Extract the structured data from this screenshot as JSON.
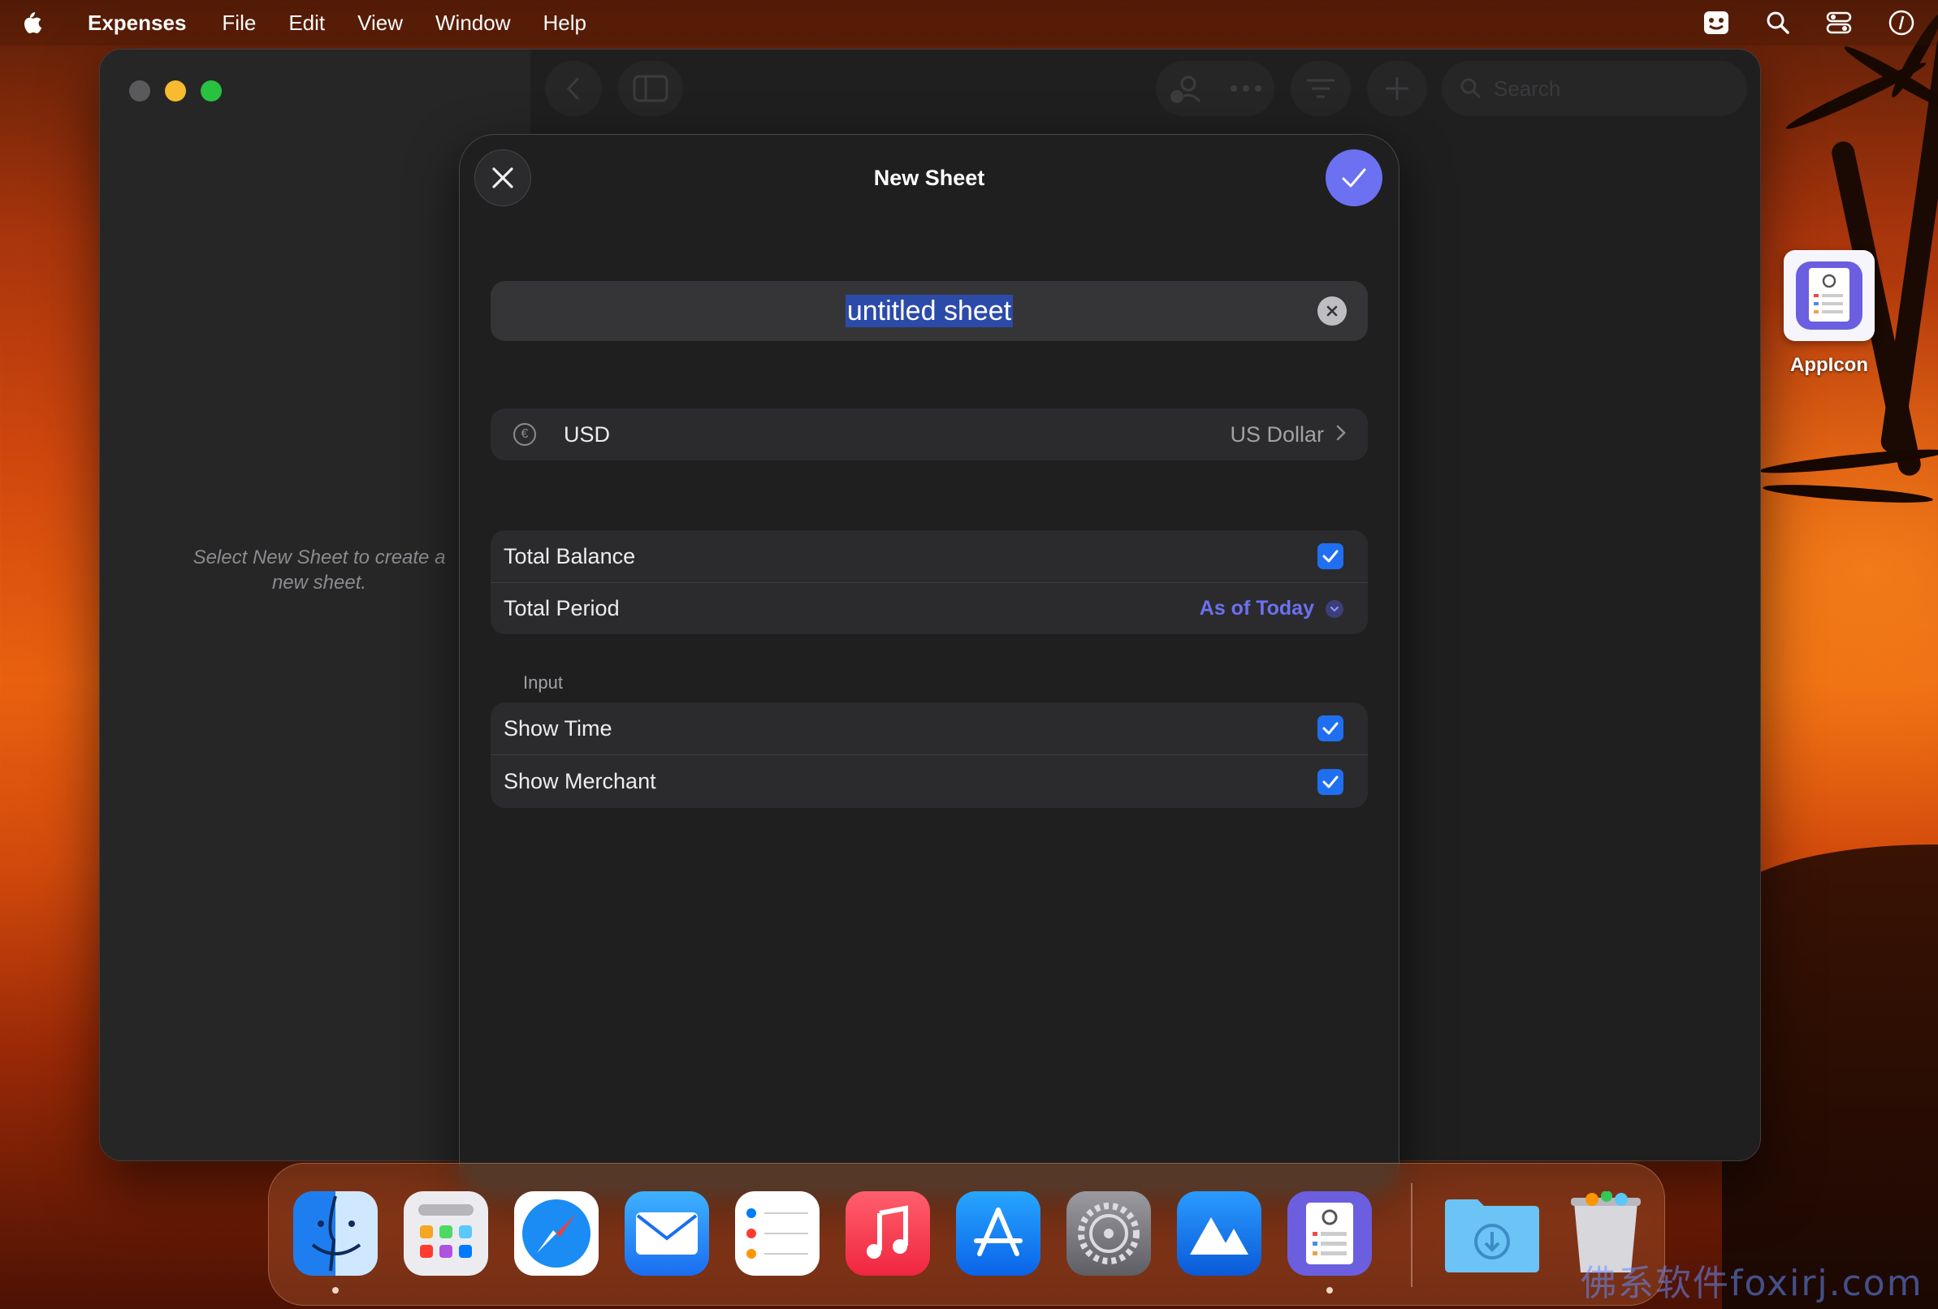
{
  "menubar": {
    "app_name": "Expenses",
    "items": [
      "File",
      "Edit",
      "View",
      "Window",
      "Help"
    ]
  },
  "window": {
    "sidebar_placeholder": "Select New Sheet to create a\nnew sheet.",
    "search_placeholder": "Search"
  },
  "sheet": {
    "title": "New Sheet",
    "name_value": "untitled sheet",
    "currency": {
      "code": "USD",
      "name": "US Dollar"
    },
    "totals": {
      "total_balance_label": "Total Balance",
      "total_balance_checked": true,
      "total_period_label": "Total Period",
      "total_period_value": "As of Today"
    },
    "input_section": {
      "header": "Input",
      "show_time_label": "Show Time",
      "show_time_checked": true,
      "show_merchant_label": "Show Merchant",
      "show_merchant_checked": true
    }
  },
  "desktop": {
    "file_name": "AppIcon"
  },
  "dock": {
    "apps": [
      "Finder",
      "Launchpad",
      "Safari",
      "Mail",
      "Reminders",
      "Music",
      "App Store",
      "System Settings",
      "Instruments",
      "Expenses",
      "Downloads",
      "Trash"
    ]
  },
  "watermark": "佛系软件foxirj.com",
  "colors": {
    "accent": "#6b71f0",
    "checkbox": "#1f6ff0",
    "traffic_close": "#5a5a5c",
    "traffic_minimize": "#f6bb2e",
    "traffic_maximize": "#29c140"
  }
}
